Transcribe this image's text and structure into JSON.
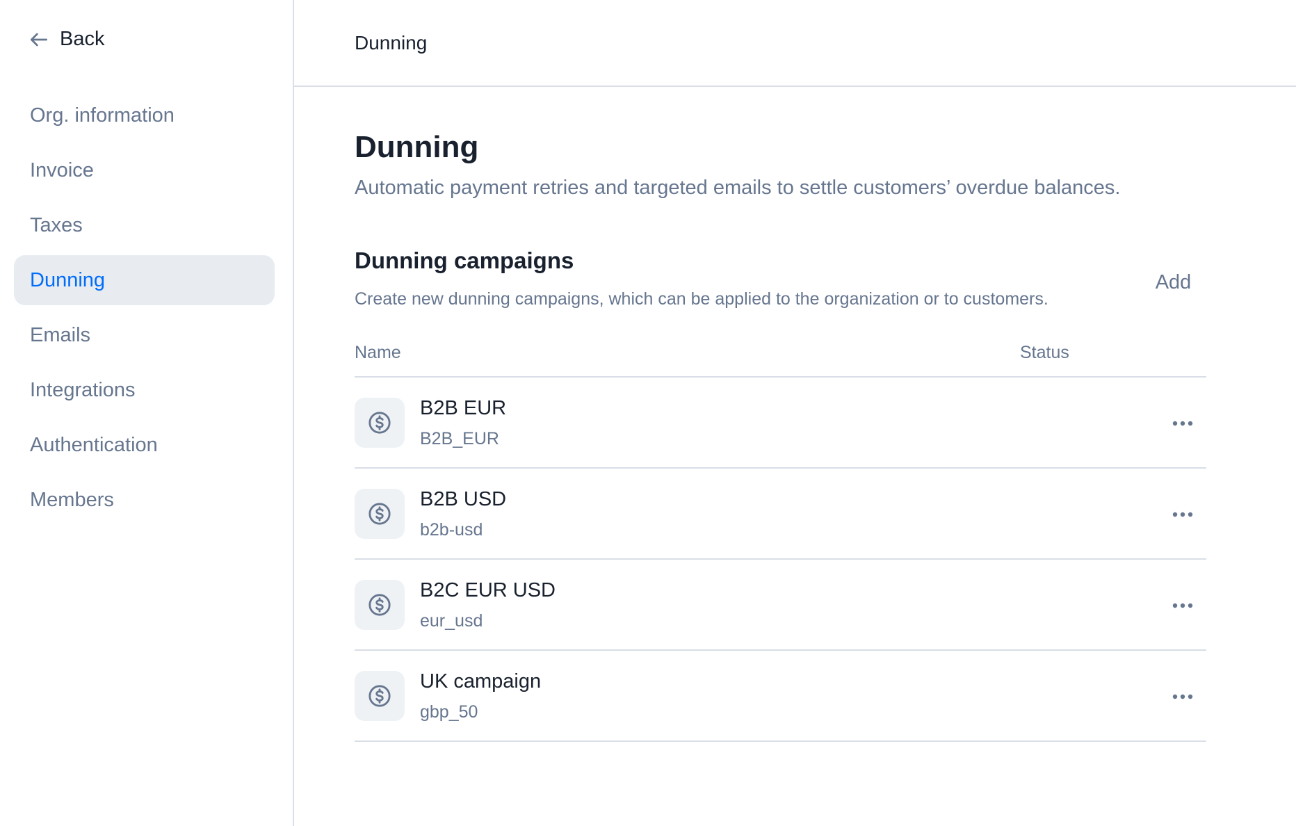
{
  "sidebar": {
    "back_label": "Back",
    "items": [
      {
        "label": "Org. information",
        "active": false
      },
      {
        "label": "Invoice",
        "active": false
      },
      {
        "label": "Taxes",
        "active": false
      },
      {
        "label": "Dunning",
        "active": true
      },
      {
        "label": "Emails",
        "active": false
      },
      {
        "label": "Integrations",
        "active": false
      },
      {
        "label": "Authentication",
        "active": false
      },
      {
        "label": "Members",
        "active": false
      }
    ]
  },
  "header": {
    "title": "Dunning"
  },
  "page": {
    "title": "Dunning",
    "subtitle": "Automatic payment retries and targeted emails to settle customers’ overdue balances."
  },
  "campaigns": {
    "title": "Dunning campaigns",
    "subtitle": "Create new dunning campaigns, which can be applied to the organization or to customers.",
    "add_label": "Add",
    "columns": {
      "name": "Name",
      "status": "Status"
    },
    "rows": [
      {
        "name": "B2B EUR",
        "code": "B2B_EUR",
        "icon": "dollar-circle-icon"
      },
      {
        "name": "B2B USD",
        "code": "b2b-usd",
        "icon": "dollar-circle-icon"
      },
      {
        "name": "B2C EUR USD",
        "code": "eur_usd",
        "icon": "dollar-circle-icon"
      },
      {
        "name": "UK campaign",
        "code": "gbp_50",
        "icon": "dollar-circle-icon"
      }
    ]
  },
  "colors": {
    "accent": "#006cfa",
    "text_primary": "#19212e",
    "text_secondary": "#66768f",
    "active_bg": "#e8ecf1",
    "border": "#d9dee7"
  }
}
